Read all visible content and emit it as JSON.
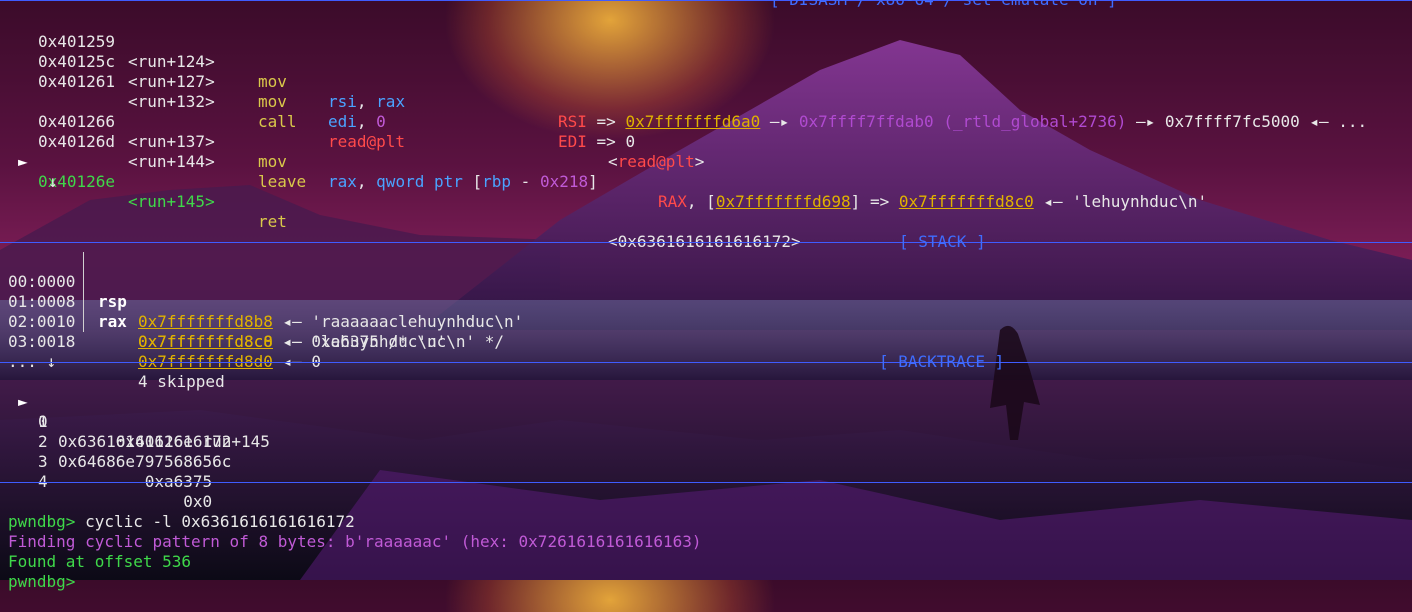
{
  "disasm": {
    "header": "[ DISASM / x86-64 / set emulate on ]",
    "lines": [
      {
        "addr": "0x401259",
        "off": "<run+124>",
        "op": "mov",
        "arg1": "rsi",
        "sep": ", ",
        "arg2": "rax",
        "c_reg": "RSI",
        "c_arrow": " => ",
        "c_addr1": "0x7fffffffd6a0",
        "c_a1": " —▸ ",
        "c_addr2": "0x7ffff7ffdab0 (_rtld_global+2736)",
        "c_a2": " —▸ ",
        "c_addr3": "0x7ffff7fc5000 ◂— ..."
      },
      {
        "addr": "0x40125c",
        "off": "<run+127>",
        "op": "mov",
        "arg1": "edi",
        "sep": ", ",
        "arg2": "0",
        "c_reg": "EDI",
        "c_arrow": " => ",
        "c_val": "0"
      },
      {
        "addr": "0x401261",
        "off": "<run+132>",
        "op": "call",
        "target": "read@plt",
        "c_lt": "<",
        "c_target": "read@plt",
        "c_gt": ">"
      },
      {
        "addr": "0x401266",
        "off": "<run+137>",
        "op": "mov",
        "arg1": "rax",
        "sep": ", ",
        "mem_kw": "qword ptr",
        "mem_open": " [",
        "mem_base": "rbp",
        "mem_minus": " - ",
        "mem_off": "0x218",
        "mem_close": "]",
        "c_reg": "RAX",
        "c_pre": ", [",
        "c_addr1": "0x7fffffffd698",
        "c_mid": "] => ",
        "c_addr2": "0x7fffffffd8c0",
        "c_tail": " ◂— 'lehuynhduc\\n'"
      },
      {
        "addr": "0x40126d",
        "off": "<run+144>",
        "op": "leave"
      },
      {
        "addr": "0x40126e",
        "off": "<run+145>",
        "op": "ret",
        "cur": "►",
        "c_ret": "<0x6361616161616172>"
      }
    ],
    "down_arrow": "↓"
  },
  "stack": {
    "header": "[ STACK ]",
    "rows": [
      {
        "idx": "00:0000",
        "reg": "rsp",
        "addr": "0x7fffffffd8b8",
        "val": " ◂— 'raaaaaaclehuynhduc\\n'"
      },
      {
        "idx": "01:0008",
        "reg": "rax",
        "addr": "0x7fffffffd8c0",
        "val": " ◂— 'lehuynhduc\\n'"
      },
      {
        "idx": "02:0010",
        "reg": "",
        "addr": "0x7fffffffd8c8",
        "val": " ◂— 0xa6375 /* 'uc\\n' */"
      },
      {
        "idx": "03:0018",
        "reg": "",
        "addr": "0x7fffffffd8d0",
        "val": " ◂— 0"
      }
    ],
    "skip_prefix": "... ↓",
    "skip_text": "4 skipped"
  },
  "backtrace": {
    "header": "[ BACKTRACE ]",
    "rows": [
      {
        "cur": "►",
        "n": "0",
        "v": "      0x40126e run+145"
      },
      {
        "cur": "",
        "n": "1",
        "v": "0x6361616161616172"
      },
      {
        "cur": "",
        "n": "2",
        "v": "0x64686e797568656c"
      },
      {
        "cur": "",
        "n": "3",
        "v": "         0xa6375"
      },
      {
        "cur": "",
        "n": "4",
        "v": "             0x0"
      }
    ]
  },
  "console": {
    "prompt": "pwndbg>",
    "command": " cyclic -l 0x6361616161616172",
    "finding": "Finding cyclic pattern of 8 bytes: b'raaaaaac' (hex: 0x7261616161616163)",
    "found": "Found at offset 536"
  },
  "colors": {
    "rule": "#3f5cff",
    "green": "#3fd84a",
    "yellow": "#e0b200",
    "red": "#ff4a4a",
    "magenta": "#c05ad6"
  }
}
